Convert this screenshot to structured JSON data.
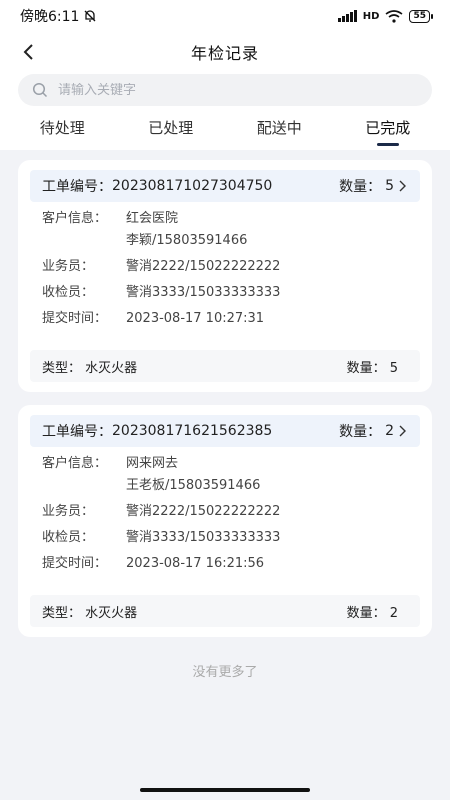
{
  "status_bar": {
    "time": "傍晚6:11",
    "network": "HD",
    "battery": "55"
  },
  "nav": {
    "title": "年检记录"
  },
  "search": {
    "placeholder": "请输入关键字"
  },
  "tabs": [
    {
      "label": "待处理",
      "active": false
    },
    {
      "label": "已处理",
      "active": false
    },
    {
      "label": "配送中",
      "active": false
    },
    {
      "label": "已完成",
      "active": true
    }
  ],
  "orders": [
    {
      "order_label": "工单编号：",
      "order_no": "202308171027304750",
      "qty_label": "数量：",
      "qty": "5",
      "customer_label": "客户信息：",
      "customer_name": "红会医院",
      "customer_contact": "李颖/15803591466",
      "salesman_label": "业务员：",
      "salesman": "警消2222/15022222222",
      "inspector_label": "收检员：",
      "inspector": "警消3333/15033333333",
      "submit_label": "提交时间：",
      "submit_time": "2023-08-17 10:27:31",
      "type_label": "类型：",
      "type": "水灭火器",
      "type_qty_label": "数量：",
      "type_qty": "5"
    },
    {
      "order_label": "工单编号：",
      "order_no": "202308171621562385",
      "qty_label": "数量：",
      "qty": "2",
      "customer_label": "客户信息：",
      "customer_name": "网来网去",
      "customer_contact": "王老板/15803591466",
      "salesman_label": "业务员：",
      "salesman": "警消2222/15022222222",
      "inspector_label": "收检员：",
      "inspector": "警消3333/15033333333",
      "submit_label": "提交时间：",
      "submit_time": "2023-08-17 16:21:56",
      "type_label": "类型：",
      "type": "水灭火器",
      "type_qty_label": "数量：",
      "type_qty": "2"
    }
  ],
  "footer": {
    "no_more": "没有更多了"
  }
}
